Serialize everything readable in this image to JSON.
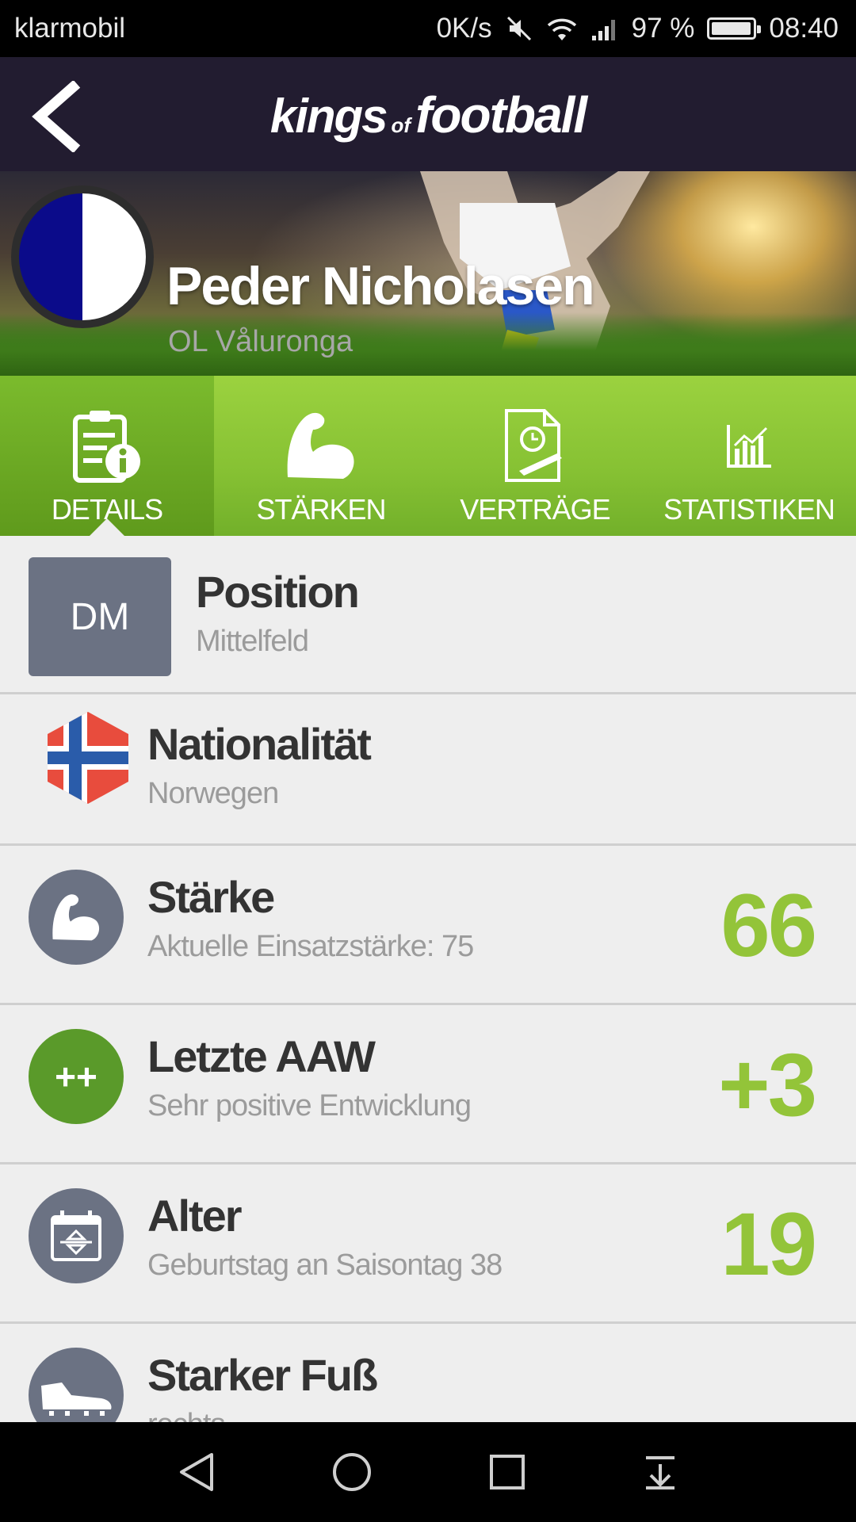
{
  "status_bar": {
    "carrier": "klarmobil",
    "speed": "0K/s",
    "battery": "97 %",
    "battery_level": 0.97,
    "time": "08:40"
  },
  "app_bar": {
    "logo_word1": "kings",
    "logo_word2": "of",
    "logo_word3": "football",
    "icons": [
      "back-arrow-icon"
    ]
  },
  "player": {
    "name": "Peder Nicholasen",
    "club": "OL Våluronga",
    "club_colors": [
      "#0b0b8a",
      "#ffffff"
    ]
  },
  "tabs": [
    {
      "label": "DETAILS",
      "icon": "details-info-icon",
      "active": true
    },
    {
      "label": "STÄRKEN",
      "icon": "muscle-arm-icon",
      "active": false
    },
    {
      "label": "VERTRÄGE",
      "icon": "contract-icon",
      "active": false
    },
    {
      "label": "STATISTIKEN",
      "icon": "chart-icon",
      "active": false
    }
  ],
  "details": {
    "position": {
      "badge": "DM",
      "title": "Position",
      "subtitle": "Mittelfeld"
    },
    "nationality": {
      "title": "Nationalität",
      "subtitle": "Norwegen",
      "icon": "norway-flag-icon"
    },
    "strength": {
      "title": "Stärke",
      "subtitle": "Aktuelle Einsatzstärke: 75",
      "value": "66",
      "icon": "muscle-arm-icon"
    },
    "last_aaw": {
      "title": "Letzte AAW",
      "subtitle": "Sehr positive Entwicklung",
      "value": "+3",
      "icon_text": "++"
    },
    "age": {
      "title": "Alter",
      "subtitle": "Geburtstag an Saisontag 38",
      "value": "19",
      "icon": "calendar-icon"
    },
    "foot": {
      "title": "Starker Fuß",
      "subtitle": "rechts",
      "icon": "football-boot-icon"
    }
  },
  "colors": {
    "accent_green": "#93c439",
    "aaw_green": "#5a9a2a",
    "icon_gray": "#6b7283",
    "appbar": "#221c30"
  },
  "nav_bar": {
    "icons": [
      "nav-back-icon",
      "nav-home-icon",
      "nav-recents-icon",
      "nav-notifications-icon"
    ]
  }
}
